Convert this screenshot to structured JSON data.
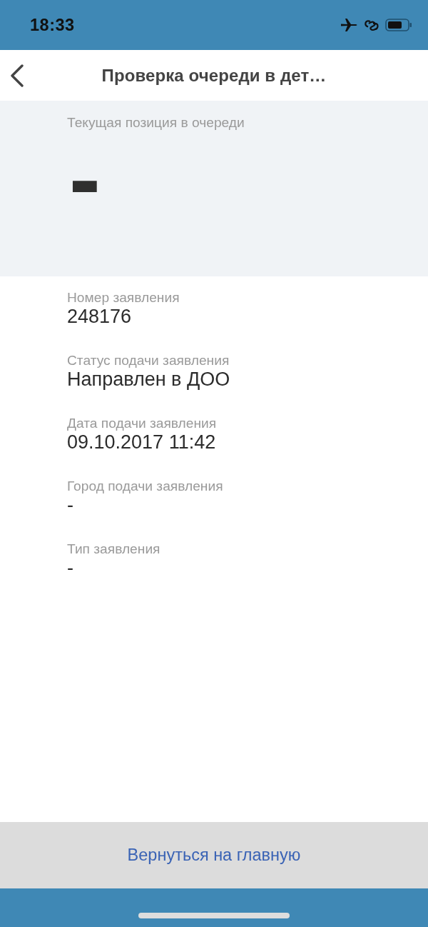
{
  "status_bar": {
    "time": "18:33"
  },
  "header": {
    "title": "Проверка очереди в дет…"
  },
  "queue_position": {
    "label": "Текущая позиция в очереди",
    "value": "-"
  },
  "fields": [
    {
      "label": "Номер заявления",
      "value": "248176"
    },
    {
      "label": "Статус подачи заявления",
      "value": "Направлен в ДОО"
    },
    {
      "label": "Дата подачи заявления",
      "value": "09.10.2017 11:42"
    },
    {
      "label": "Город подачи заявления",
      "value": "-"
    },
    {
      "label": "Тип заявления",
      "value": "-"
    }
  ],
  "footer_button": {
    "label": "Вернуться на главную"
  }
}
